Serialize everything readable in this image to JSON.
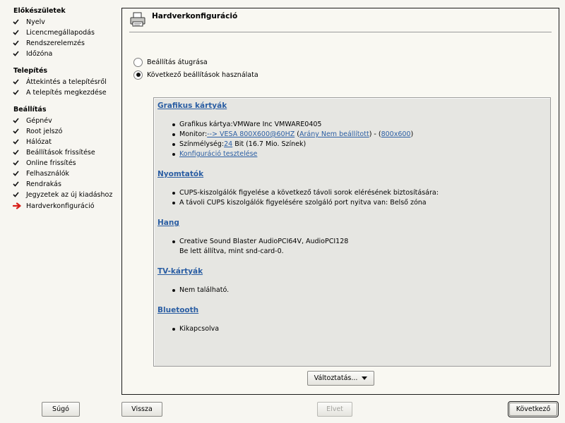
{
  "sidebar": {
    "sections": [
      {
        "title": "Előkészületek",
        "items": [
          {
            "label": "Nyelv",
            "state": "done"
          },
          {
            "label": "Licencmegállapodás",
            "state": "done"
          },
          {
            "label": "Rendszerelemzés",
            "state": "done"
          },
          {
            "label": "Időzóna",
            "state": "done"
          }
        ]
      },
      {
        "title": "Telepítés",
        "items": [
          {
            "label": "Áttekintés a telepítésről",
            "state": "done"
          },
          {
            "label": "A telepítés megkezdése",
            "state": "done"
          }
        ]
      },
      {
        "title": "Beállítás",
        "items": [
          {
            "label": "Gépnév",
            "state": "done"
          },
          {
            "label": "Root jelszó",
            "state": "done"
          },
          {
            "label": "Hálózat",
            "state": "done"
          },
          {
            "label": "Beállítások frissítése",
            "state": "done"
          },
          {
            "label": "Online frissítés",
            "state": "done"
          },
          {
            "label": "Felhasználók",
            "state": "done"
          },
          {
            "label": "Rendrakás",
            "state": "done"
          },
          {
            "label": "Jegyzetek az új kiadáshoz",
            "state": "done"
          },
          {
            "label": "Hardverkonfiguráció",
            "state": "current"
          }
        ]
      }
    ]
  },
  "header": {
    "title": "Hardverkonfiguráció",
    "icon": "printer-icon"
  },
  "options": [
    {
      "label": "Beállítás átugrása",
      "selected": false
    },
    {
      "label": "Következő beállítások használata",
      "selected": true
    }
  ],
  "summary": {
    "graphics": {
      "heading": "Grafikus kártyák",
      "card": "Grafikus kártya:VMWare Inc VMWARE0405",
      "monitor_prefix": "Monitor:",
      "monitor_link": "--> VESA 800X600@60HZ",
      "paren_open": " (",
      "ratio_link": "Arány Nem beállított",
      "paren_sep": ") - (",
      "resolution_link": "800x600",
      "paren_close": ")",
      "depth_prefix": "Színmélység:",
      "depth_link": "24",
      "depth_suffix": " Bit (16.7 Mio. Színek)",
      "test_link": "Konfiguráció tesztelése"
    },
    "printers": {
      "heading": "Nyomtatók",
      "items": [
        "CUPS-kiszolgálók figyelése a következő távoli sorok elérésének biztosítására:",
        "A távoli CUPS kiszolgálók figyelésére szolgáló port nyitva van: Belső zóna"
      ]
    },
    "sound": {
      "heading": "Hang",
      "line1": "Creative Sound Blaster AudioPCI64V, AudioPCI128",
      "line2": "Be lett állítva, mint snd-card-0."
    },
    "tv": {
      "heading": "TV-kártyák",
      "item": "Nem található."
    },
    "bluetooth": {
      "heading": "Bluetooth",
      "item": "Kikapcsolva"
    }
  },
  "change_button": {
    "label": "Változtatás..."
  },
  "footer": {
    "help": "Súgó",
    "back": "Vissza",
    "abort": "Elvet",
    "next": "Következő"
  },
  "colors": {
    "link": "#2b5ea3",
    "current_arrow": "#d8201a",
    "background": "#f7f6f1"
  }
}
